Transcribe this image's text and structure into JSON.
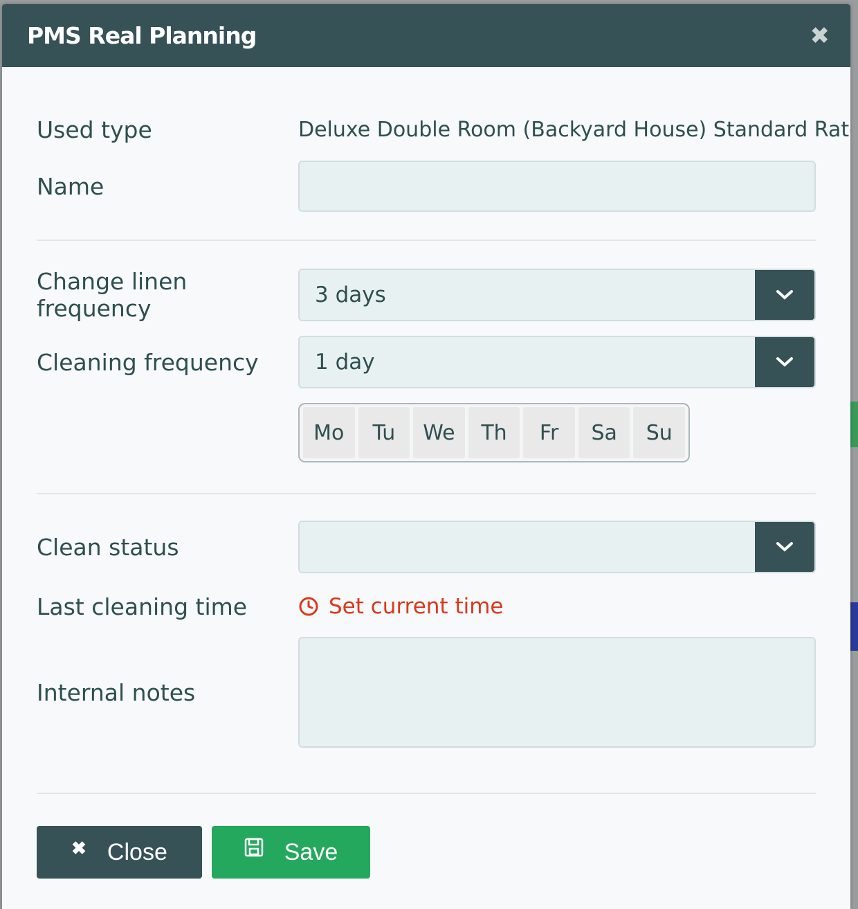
{
  "dialog": {
    "title": "PMS Real Planning",
    "close_icon": "close-icon"
  },
  "form": {
    "used_type": {
      "label": "Used type",
      "value": "Deluxe Double Room (Backyard House) Standard Rate"
    },
    "name": {
      "label": "Name",
      "value": ""
    },
    "linen_frequency": {
      "label": "Change linen frequency",
      "value": "3 days"
    },
    "cleaning_frequency": {
      "label": "Cleaning frequency",
      "value": "1 day"
    },
    "days": [
      "Mo",
      "Tu",
      "We",
      "Th",
      "Fr",
      "Sa",
      "Su"
    ],
    "clean_status": {
      "label": "Clean status",
      "value": ""
    },
    "last_cleaning_time": {
      "label": "Last cleaning time",
      "action": "Set current time"
    },
    "internal_notes": {
      "label": "Internal notes",
      "value": ""
    }
  },
  "footer": {
    "close_label": "Close",
    "save_label": "Save"
  },
  "colors": {
    "header": "#365257",
    "save": "#24a85e",
    "accent_red": "#d9381e"
  }
}
